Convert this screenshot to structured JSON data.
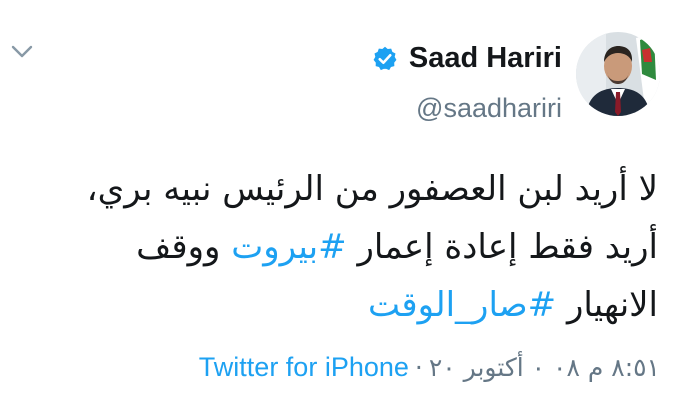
{
  "colors": {
    "accent": "#1da1f2",
    "secondary_text": "#657786",
    "primary_text": "#14171a"
  },
  "header": {
    "display_name": "Saad Hariri",
    "handle": "@saadhariri",
    "verified_icon": "verified-badge-icon",
    "menu_icon": "chevron-down-icon"
  },
  "tweet": {
    "line1": "لا أريد لبن العصفور من الرئيس نبيه بري،",
    "line2_prefix": "أريد فقط إعادة إعمار ",
    "line2_hashtag": "#بيروت",
    "line2_suffix": " ووقف",
    "line3_prefix": "الانهيار ",
    "line3_hashtag": "#صار_الوقت"
  },
  "meta": {
    "datetime": "٨:٥١ م ٠٨ ٠ أكتوبر ٢٠",
    "separator": "·",
    "source": "Twitter for iPhone"
  }
}
